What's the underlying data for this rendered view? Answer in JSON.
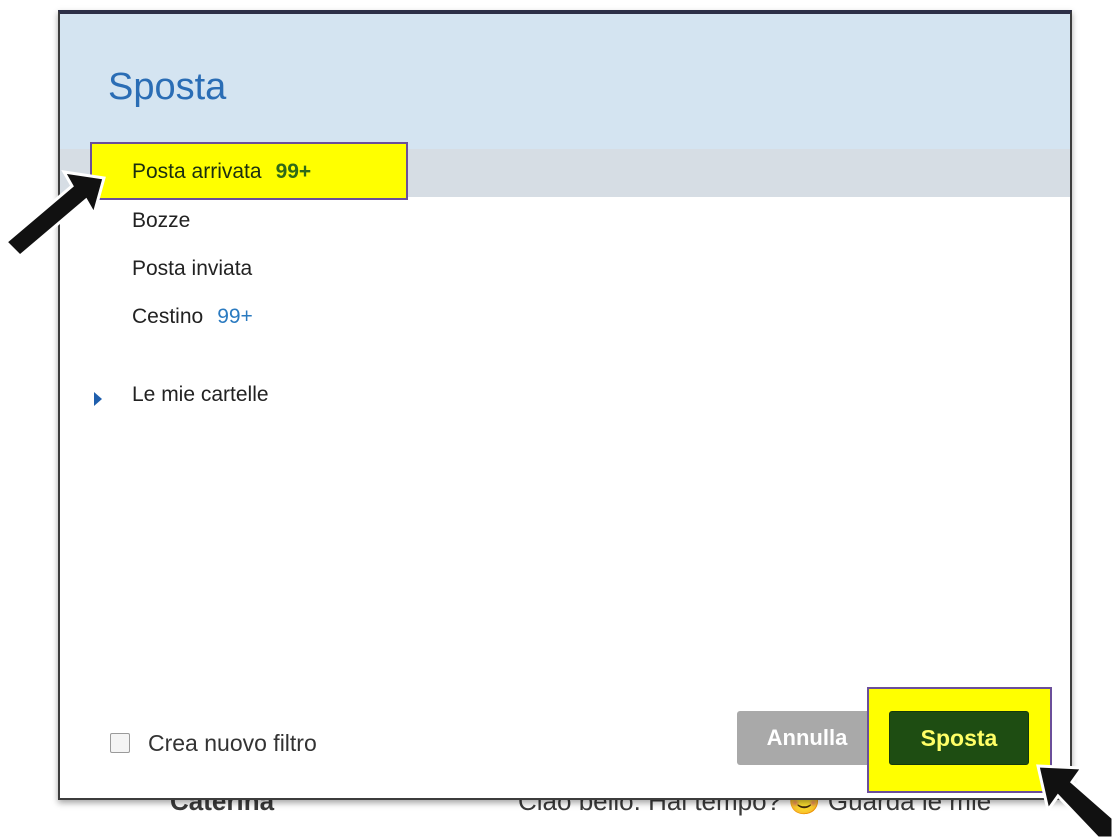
{
  "background": {
    "sender": "Caterina",
    "subject_preview": "Ciao bello. Hai tempo?",
    "emoji": "😊",
    "snippet": "Guarda le mie"
  },
  "dialog": {
    "title": "Sposta",
    "folders": [
      {
        "label": "Posta arrivata",
        "count": "99+",
        "selected": true
      },
      {
        "label": "Bozze",
        "count": ""
      },
      {
        "label": "Posta inviata",
        "count": ""
      },
      {
        "label": "Cestino",
        "count": "99+"
      }
    ],
    "my_folders_label": "Le mie cartelle",
    "create_filter_label": "Crea nuovo filtro",
    "create_filter_checked": false,
    "cancel_label": "Annulla",
    "move_label": "Sposta"
  },
  "colors": {
    "header_bg": "#d4e4f1",
    "title": "#2a6db5",
    "highlight": "#ffff00",
    "highlight_border": "#6b4f9a",
    "move_button": "#1e4d12",
    "cancel_button": "#a9a9a9",
    "count": "#2a7ac0"
  },
  "icons": {
    "my_folders_caret": "caret-right-icon",
    "annotation": "black-arrow-pointer-icon"
  }
}
